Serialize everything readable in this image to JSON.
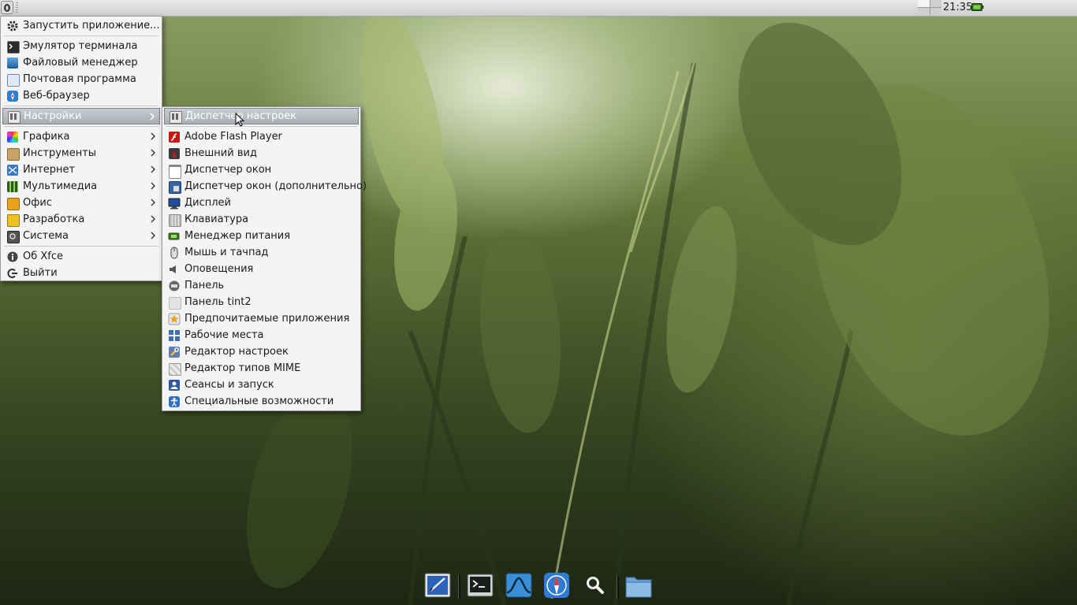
{
  "panel": {
    "clock": "21:35"
  },
  "main_menu": {
    "items": [
      {
        "label": "Запустить приложение...",
        "icon": "gear-icon"
      },
      {
        "label": "Эмулятор терминала",
        "icon": "terminal-icon"
      },
      {
        "label": "Файловый менеджер",
        "icon": "file-manager-icon"
      },
      {
        "label": "Почтовая программа",
        "icon": "mail-icon"
      },
      {
        "label": "Веб-браузер",
        "icon": "compass-icon"
      },
      {
        "label": "Настройки",
        "icon": "settings-icon",
        "submenu": true
      },
      {
        "label": "Графика",
        "icon": "graphics-icon",
        "submenu": true
      },
      {
        "label": "Инструменты",
        "icon": "tools-icon",
        "submenu": true
      },
      {
        "label": "Интернет",
        "icon": "internet-icon",
        "submenu": true
      },
      {
        "label": "Мультимедиа",
        "icon": "multimedia-icon",
        "submenu": true
      },
      {
        "label": "Офис",
        "icon": "office-icon",
        "submenu": true
      },
      {
        "label": "Разработка",
        "icon": "development-icon",
        "submenu": true
      },
      {
        "label": "Система",
        "icon": "system-icon",
        "submenu": true
      },
      {
        "label": "Об Xfce",
        "icon": "info-icon"
      },
      {
        "label": "Выйти",
        "icon": "logout-icon"
      }
    ]
  },
  "settings_menu": {
    "items": [
      {
        "label": "Диспетчер настроек",
        "icon": "settings-manager-icon"
      },
      {
        "label": "Adobe Flash Player",
        "icon": "flash-icon"
      },
      {
        "label": "Внешний вид",
        "icon": "appearance-icon"
      },
      {
        "label": "Диспетчер окон",
        "icon": "window-icon"
      },
      {
        "label": "Диспетчер окон (дополнительно)",
        "icon": "window-tweaks-icon"
      },
      {
        "label": "Дисплей",
        "icon": "display-icon"
      },
      {
        "label": "Клавиатура",
        "icon": "keyboard-icon"
      },
      {
        "label": "Менеджер питания",
        "icon": "battery-icon"
      },
      {
        "label": "Мышь и тачпад",
        "icon": "mouse-icon"
      },
      {
        "label": "Оповещения",
        "icon": "notifications-icon"
      },
      {
        "label": "Панель",
        "icon": "panel-icon"
      },
      {
        "label": "Панель tint2",
        "icon": "tint2-icon"
      },
      {
        "label": "Предпочитаемые приложения",
        "icon": "star-icon"
      },
      {
        "label": "Рабочие места",
        "icon": "workspaces-icon"
      },
      {
        "label": "Редактор настроек",
        "icon": "wrench-icon"
      },
      {
        "label": "Редактор типов MIME",
        "icon": "mime-icon"
      },
      {
        "label": "Сеансы и запуск",
        "icon": "session-icon"
      },
      {
        "label": "Специальные возможности",
        "icon": "accessibility-icon"
      }
    ]
  },
  "dock": {
    "items": [
      "text-editor-icon",
      "terminal-icon",
      "wave-icon",
      "compass-icon",
      "search-icon",
      "folder-icon"
    ]
  },
  "colors": {
    "menu_bg": "#f4f4f4",
    "highlight": "#a9adb5",
    "panel_bg": "#dcdcdc"
  }
}
